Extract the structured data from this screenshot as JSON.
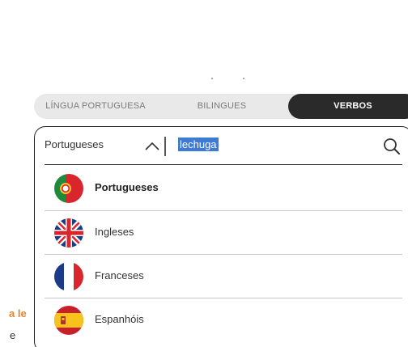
{
  "tabs": [
    {
      "label": "LÍNGUA PORTUGUESA",
      "active": false
    },
    {
      "label": "BILINGUES",
      "active": false
    },
    {
      "label": "VERBOS",
      "active": true
    }
  ],
  "background": {
    "fragment_1": "a le",
    "fragment_2": "e"
  },
  "search": {
    "selected_language": "Portugueses",
    "query": "lechuga"
  },
  "language_options": [
    {
      "label": "Portugueses",
      "icon": "portugal-flag-icon",
      "selected": true
    },
    {
      "label": "Ingleses",
      "icon": "uk-flag-icon",
      "selected": false
    },
    {
      "label": "Franceses",
      "icon": "france-flag-icon",
      "selected": false
    },
    {
      "label": "Espanhóis",
      "icon": "spain-flag-icon",
      "selected": false
    }
  ],
  "colors": {
    "active_tab_bg": "#2a2a2a",
    "tabs_bg": "#e9e9e9",
    "selection_highlight": "#3d7bd4",
    "accent_orange": "#e0862e"
  }
}
